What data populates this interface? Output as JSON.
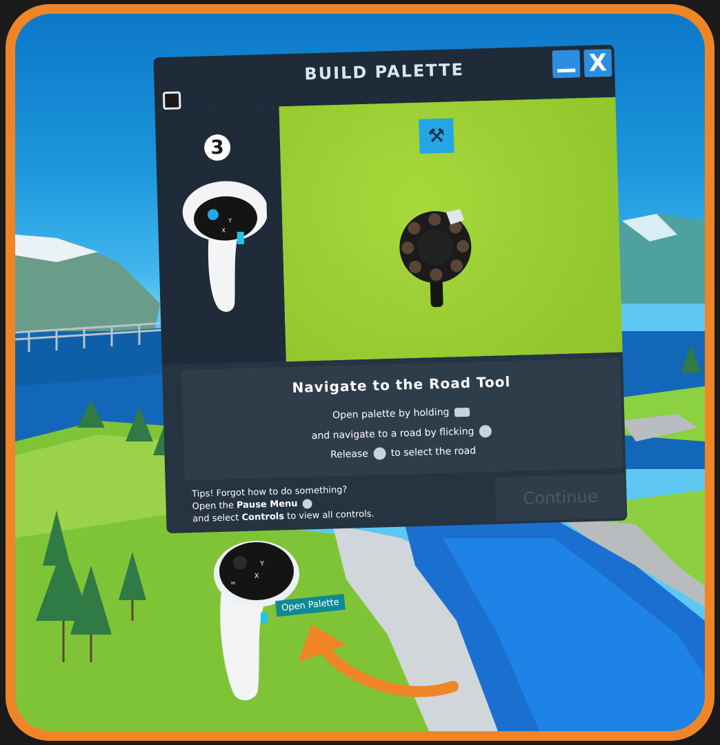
{
  "palette": {
    "title": "BUILD PALETTE",
    "close_label": "X",
    "step_number": "3",
    "tool_icon": "hammer-wrench-icon",
    "heading": "Navigate to the Road Tool",
    "instructions": {
      "line1": "Open palette by holding",
      "line2": "and navigate to a road by flicking",
      "line3_prefix": "Release",
      "line3_suffix": "to select the road"
    },
    "tips": {
      "line1": "Tips! Forgot how to do something?",
      "line2_prefix": "Open the",
      "line2_bold": "Pause Menu",
      "line3_prefix": "and select",
      "line3_bold": "Controls",
      "line3_suffix": "to view all controls."
    },
    "continue_label": "Continue"
  },
  "controller": {
    "label": "Open Palette",
    "buttons": [
      "Y",
      "X",
      "="
    ]
  },
  "colors": {
    "frame": "#ef8527",
    "panel": "#1f2b38",
    "accent": "#22a6e8",
    "grass": "#9acd32"
  }
}
